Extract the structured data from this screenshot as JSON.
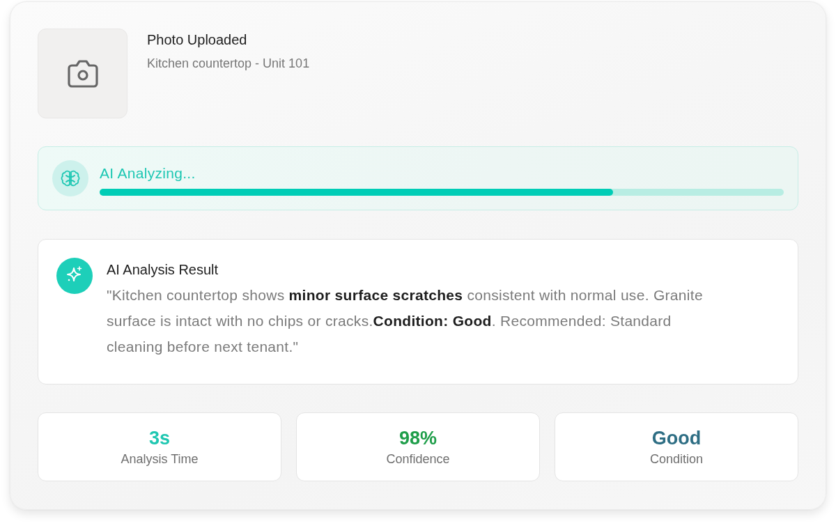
{
  "photo": {
    "title": "Photo Uploaded",
    "subtitle": "Kitchen countertop - Unit 101"
  },
  "analysis_status": {
    "label": "AI Analyzing...",
    "level": 0.75
  },
  "result": {
    "title": "AI Analysis Result",
    "text": "\"Kitchen countertop shows **minor surface scratches** consistent with normal use. Granite surface is intact with no chips or cracks.**Condition: Good**. Recommended: Standard cleaning before next tenant.\""
  },
  "stats": [
    {
      "value": "3s",
      "label": "Analysis Time",
      "color": "#1fc7b1"
    },
    {
      "value": "98%",
      "label": "Confidence",
      "color": "#1f9e4a"
    },
    {
      "value": "Good",
      "label": "Condition",
      "color": "#2e6e84"
    }
  ]
}
